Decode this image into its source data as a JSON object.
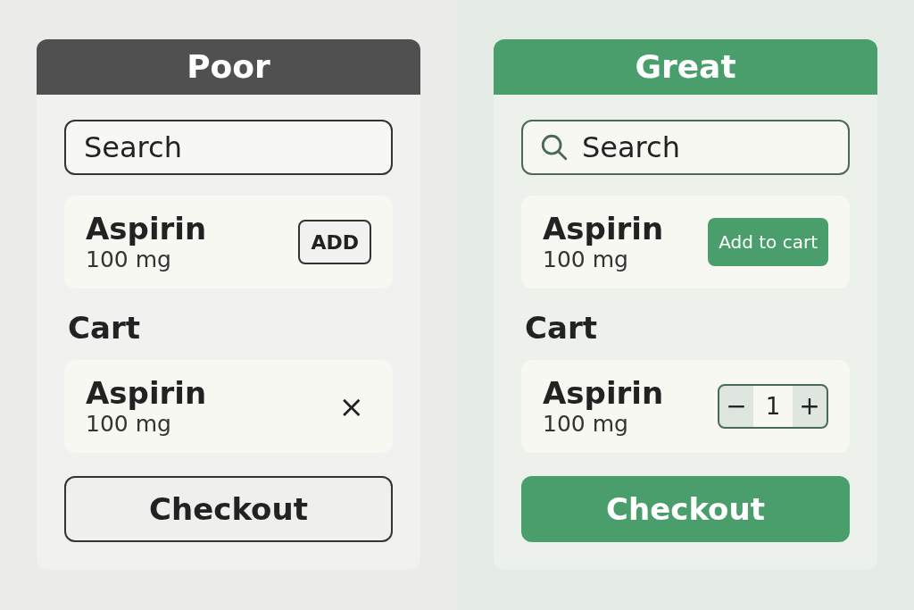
{
  "panels": [
    {
      "kind": "poor",
      "title": "Poor",
      "search": {
        "placeholder": "Search",
        "icon": false
      },
      "product": {
        "name": "Aspirin",
        "dose": "100 mg",
        "action": "ADD"
      },
      "cart_label": "Cart",
      "cart_item": {
        "name": "Aspirin",
        "dose": "100 mg",
        "control": {
          "kind": "remove",
          "symbol": "×"
        }
      },
      "checkout": "Checkout"
    },
    {
      "kind": "great",
      "title": "Great",
      "search": {
        "placeholder": "Search",
        "icon": true
      },
      "product": {
        "name": "Aspirin",
        "dose": "100 mg",
        "action": "Add to cart"
      },
      "cart_label": "Cart",
      "cart_item": {
        "name": "Aspirin",
        "dose": "100 mg",
        "control": {
          "kind": "stepper",
          "minus": "−",
          "quantity": "1",
          "plus": "+"
        }
      },
      "checkout": "Checkout"
    }
  ]
}
